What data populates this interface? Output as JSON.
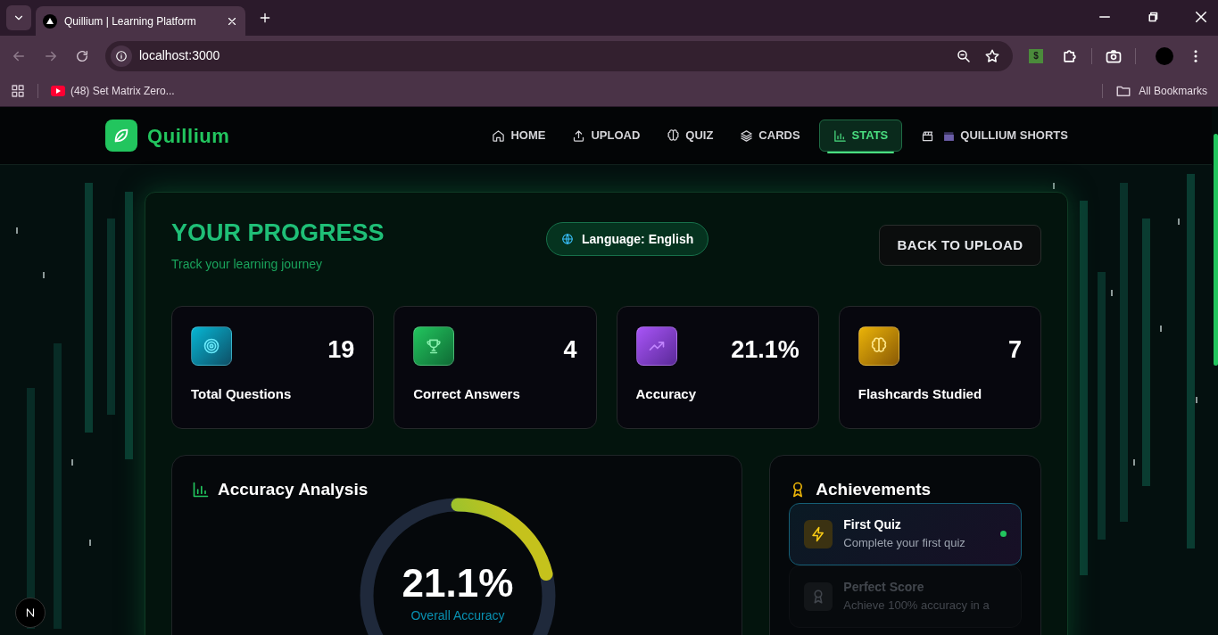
{
  "browser": {
    "tab_title": "Quillium | Learning Platform",
    "address": "localhost:3000",
    "bookmarks": [
      {
        "label": "(48) Set Matrix Zero..."
      }
    ],
    "all_bookmarks": "All Bookmarks",
    "extension_label": "$"
  },
  "app": {
    "brand": "Quillium",
    "nav": [
      {
        "label": "HOME",
        "kind": "home",
        "selected": false
      },
      {
        "label": "UPLOAD",
        "kind": "upload",
        "selected": false
      },
      {
        "label": "QUIZ",
        "kind": "brain",
        "selected": false
      },
      {
        "label": "CARDS",
        "kind": "layers",
        "selected": false
      },
      {
        "label": "STATS",
        "kind": "chart",
        "selected": true
      },
      {
        "label": "QUILLIUM SHORTS",
        "kind": "clapper",
        "selected": false
      }
    ]
  },
  "progress": {
    "title": "YOUR PROGRESS",
    "subtitle": "Track your learning journey",
    "language": "Language: English",
    "back_button": "BACK TO UPLOAD",
    "stats": [
      {
        "kind": "target",
        "value": "19",
        "label": "Total Questions"
      },
      {
        "kind": "trophy",
        "value": "4",
        "label": "Correct Answers"
      },
      {
        "kind": "trend",
        "value": "21.1%",
        "label": "Accuracy"
      },
      {
        "kind": "brain",
        "value": "7",
        "label": "Flashcards Studied"
      }
    ],
    "accuracy": {
      "title": "Accuracy Analysis",
      "level": 0.211,
      "reading": "21.1%",
      "caption": "Overall Accuracy"
    },
    "achievements": {
      "title": "Achievements",
      "items": [
        {
          "kind": "bolt",
          "title": "First Quiz",
          "description": "Complete your first quiz",
          "unlocked": true
        },
        {
          "kind": "medal",
          "title": "Perfect Score",
          "description": "Achieve 100% accuracy in a",
          "unlocked": false
        }
      ]
    }
  }
}
